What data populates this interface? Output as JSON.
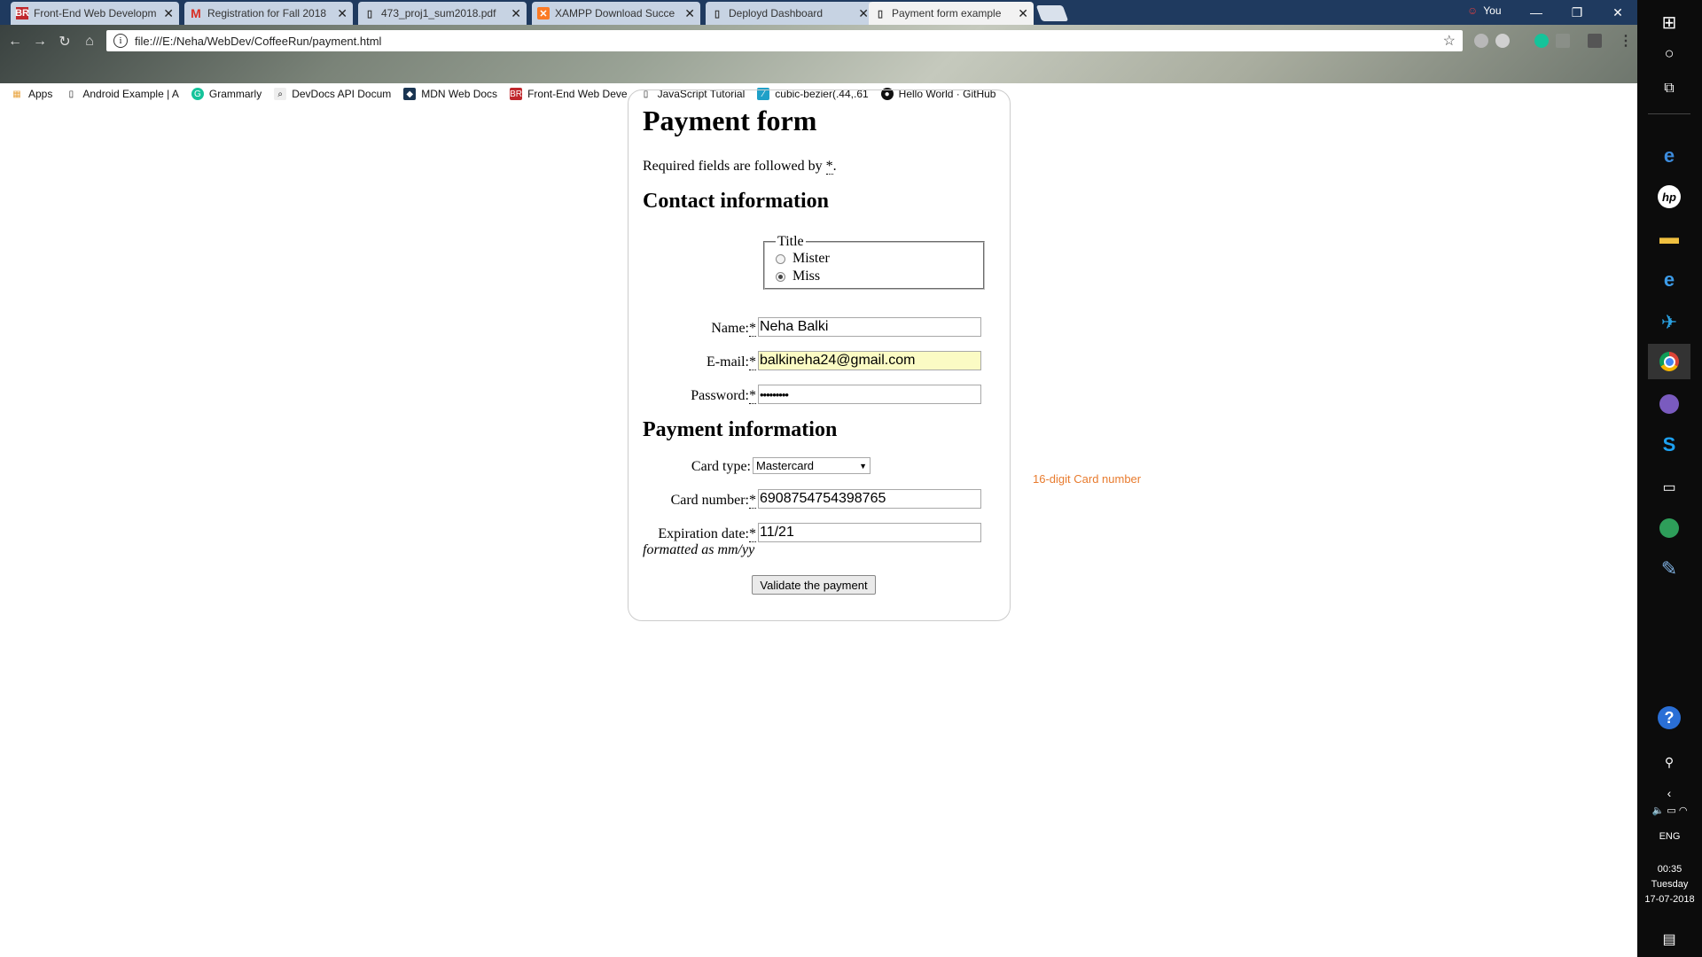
{
  "browser": {
    "tabs": [
      {
        "label": "Front-End Web Developm",
        "icon": "bnr-icon",
        "active": false
      },
      {
        "label": "Registration for Fall 2018",
        "icon": "gmail-icon",
        "active": false
      },
      {
        "label": "473_proj1_sum2018.pdf",
        "icon": "document-icon",
        "active": false
      },
      {
        "label": "XAMPP Download Succe",
        "icon": "xampp-icon",
        "active": false
      },
      {
        "label": "Deployd Dashboard",
        "icon": "document-icon",
        "active": false
      },
      {
        "label": "Payment form example",
        "icon": "document-icon",
        "active": true
      }
    ],
    "profile_name": "You",
    "window_controls": {
      "minimize": "—",
      "restore": "❐",
      "close": "✕"
    },
    "url": "file:///E:/Neha/WebDev/CoffeeRun/payment.html",
    "bookmarks": [
      {
        "label": "Apps",
        "icon": "apps-icon"
      },
      {
        "label": "Android Example | A",
        "icon": "document-icon"
      },
      {
        "label": "Grammarly",
        "icon": "grammarly-icon"
      },
      {
        "label": "DevDocs API Docum",
        "icon": "devdocs-icon"
      },
      {
        "label": "MDN Web Docs",
        "icon": "mdn-icon"
      },
      {
        "label": "Front-End Web Deve",
        "icon": "bnr-icon"
      },
      {
        "label": "JavaScript Tutorial",
        "icon": "document-icon"
      },
      {
        "label": "cubic-bezier(.44,.61",
        "icon": "cubic-bezier-icon"
      },
      {
        "label": "Hello World · GitHub",
        "icon": "github-icon"
      }
    ]
  },
  "form": {
    "title": "Payment form",
    "required_note_prefix": "Required fields are followed by ",
    "required_marker": "*",
    "required_note_suffix": ".",
    "contact_heading": "Contact information",
    "title_legend": "Title",
    "title_options": [
      {
        "label": "Mister",
        "checked": false
      },
      {
        "label": "Miss",
        "checked": true
      }
    ],
    "name_label": "Name:",
    "name_value": "Neha Balki",
    "email_label": "E-mail:",
    "email_value": "balkineha24@gmail.com",
    "password_label": "Password:",
    "password_value": "•••••••••",
    "payment_heading": "Payment information",
    "card_type_label": "Card type:",
    "card_type_value": "Mastercard",
    "card_number_label": "Card number:",
    "card_number_value": "6908754754398765",
    "expiration_label": "Expiration date:",
    "expiration_value": "11/21",
    "format_note": "formatted as mm/yy",
    "validate_label": "Validate the payment"
  },
  "card_hint": "16-digit Card number",
  "taskbar": {
    "language": "ENG",
    "time": "00:35",
    "day": "Tuesday",
    "date": "17-07-2018"
  }
}
